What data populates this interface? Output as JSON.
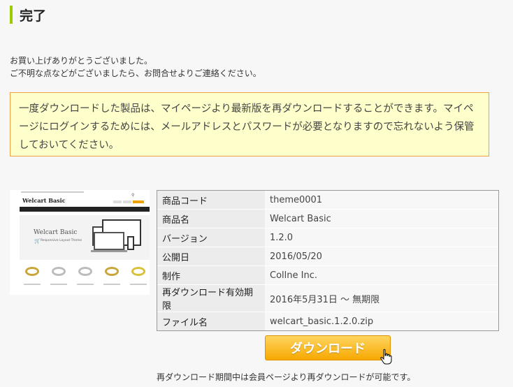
{
  "page_title": "完了",
  "thanks": {
    "line1": "お買い上げありがとうございました。",
    "line2": "ご不明な点などがございましたら、お問合せよりご連絡ください。"
  },
  "notice": "一度ダウンロードした製品は、マイページより最新版を再ダウンロードすることができます。マイページにログインするためには、メールアドレスとパスワードが必要となりますので忘れないよう保管しておいてください。",
  "thumbnail": {
    "logo": "Welcart Basic",
    "hero_title": "Welcart Basic",
    "hero_subtitle": "Responsive Layout Theme"
  },
  "product_info": [
    {
      "label": "商品コード",
      "value": "theme0001"
    },
    {
      "label": "商品名",
      "value": "Welcart Basic"
    },
    {
      "label": "バージョン",
      "value": "1.2.0"
    },
    {
      "label": "公開日",
      "value": "2016/05/20"
    },
    {
      "label": "制作",
      "value": "Collne Inc."
    },
    {
      "label": "再ダウンロード有効期限",
      "value": "2016年5月31日 ～ 無期限"
    },
    {
      "label": "ファイル名",
      "value": "welcart_basic.1.2.0.zip"
    }
  ],
  "download_button": "ダウンロード",
  "footer_note": "再ダウンロード期間中は会員ページより再ダウンロードが可能です。",
  "colors": {
    "accent_bar": "#9ccc00",
    "notice_bg": "#ffffcc",
    "notice_border": "#f0a040",
    "button": "#f7a800"
  },
  "icons": [
    "cursor-hand-icon",
    "cart-icon",
    "search-icon"
  ]
}
